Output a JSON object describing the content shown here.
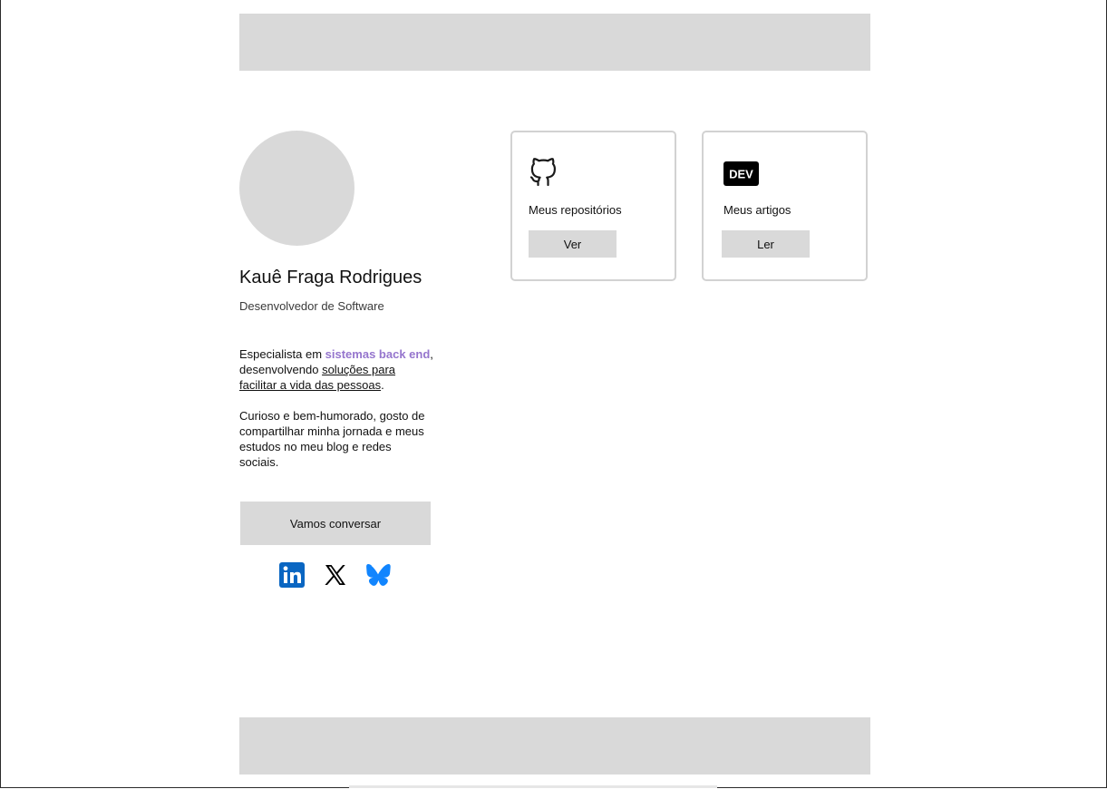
{
  "profile": {
    "name": "Kauê Fraga Rodrigues",
    "role": "Desenvolvedor de Software",
    "bio_1": {
      "prefix": "Especialista em ",
      "highlight": "sistemas back end",
      "middle": ", desenvolvendo ",
      "underline": "soluções para facilitar a vida das pessoas",
      "suffix": "."
    },
    "bio_2": "Curioso e bem-humorado, gosto de compartilhar minha jornada e meus estudos no meu blog e redes sociais.",
    "contact_button": "Vamos conversar"
  },
  "social": [
    {
      "name": "linkedin-icon",
      "color": "#0a66c2"
    },
    {
      "name": "x-icon",
      "color": "#000000"
    },
    {
      "name": "bluesky-icon",
      "color": "#1185fe"
    }
  ],
  "cards": [
    {
      "icon": "github-icon",
      "title": "Meus repositórios",
      "button": "Ver"
    },
    {
      "icon": "dev-icon",
      "title": "Meus artigos",
      "button": "Ler",
      "icon_text": "DEV"
    }
  ],
  "colors": {
    "placeholder": "#d9d9d9",
    "accent": "#9575cd",
    "card_border": "#d2d2d2"
  }
}
